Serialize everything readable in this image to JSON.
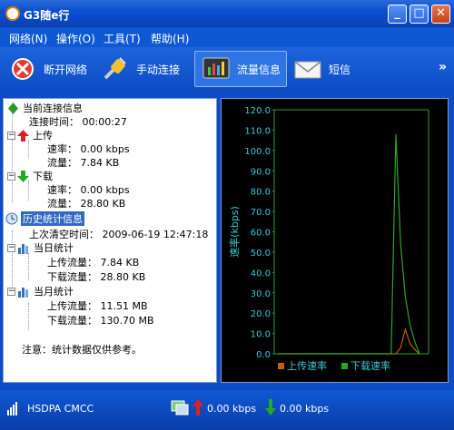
{
  "window": {
    "title": "G3随e行",
    "min_label": "_",
    "max_label": "□",
    "close_label": "✕"
  },
  "menu": [
    {
      "label": "网络(N)"
    },
    {
      "label": "操作(O)"
    },
    {
      "label": "工具(T)"
    },
    {
      "label": "帮助(H)"
    }
  ],
  "toolbar": {
    "disconnect": "断开网络",
    "manual_connect": "手动连接",
    "traffic_info": "流量信息",
    "sms": "短信",
    "more": "»"
  },
  "tree": {
    "current": "当前连接信息",
    "conn_time": "连接时间：  00:00:27",
    "upload": "上传",
    "up_rate": "速率：  0.00 kbps",
    "up_flow": "流量：  7.84 KB",
    "download": "下载",
    "down_rate": "速率：  0.00 kbps",
    "down_flow": "流量：  28.80 KB",
    "history": "历史统计信息",
    "last_clear": "上次清空时间：  2009-06-19 12:47:18",
    "today": "当日统计",
    "today_up": "上传流量：  7.84 KB",
    "today_down": "下载流量：  28.80 KB",
    "month": "当月统计",
    "month_up": "上传流量：  11.51 MB",
    "month_down": "下载流量：  130.70 MB",
    "note": "注意：统计数据仅供参考。"
  },
  "chart_data": {
    "type": "line",
    "ylabel": "速率(kbps)",
    "ylim": [
      0,
      120
    ],
    "yticks": [
      "120.0",
      "110.0",
      "100.0",
      "90.0",
      "80.0",
      "70.0",
      "60.0",
      "50.0",
      "40.0",
      "30.0",
      "20.0",
      "10.0",
      "0.0"
    ],
    "grid": false,
    "background": "#000000",
    "series": [
      {
        "name": "上传速率",
        "color": "#c06010",
        "x": [
          0,
          1,
          2,
          3,
          4,
          5,
          6,
          7,
          8,
          9,
          10,
          11,
          12,
          13,
          14,
          15,
          16,
          17,
          18,
          19,
          20,
          21,
          22,
          23,
          24,
          25,
          26,
          27,
          28,
          29,
          30
        ],
        "values": [
          0,
          0,
          0,
          0,
          0,
          0,
          0,
          0,
          0,
          0,
          0,
          0,
          0,
          0,
          0,
          0,
          0,
          0,
          0,
          0,
          0,
          0,
          0,
          0,
          0,
          0,
          3,
          12,
          5,
          2,
          0
        ]
      },
      {
        "name": "下载速率",
        "color": "#22aa22",
        "x": [
          0,
          1,
          2,
          3,
          4,
          5,
          6,
          7,
          8,
          9,
          10,
          11,
          12,
          13,
          14,
          15,
          16,
          17,
          18,
          19,
          20,
          21,
          22,
          23,
          24,
          25,
          26,
          27,
          28,
          29,
          30
        ],
        "values": [
          0,
          0,
          0,
          0,
          0,
          0,
          0,
          0,
          0,
          0,
          0,
          0,
          0,
          0,
          0,
          0,
          0,
          0,
          0,
          0,
          0,
          0,
          0,
          0,
          0,
          108,
          54,
          28,
          14,
          6,
          0
        ]
      }
    ],
    "legend": "bottom"
  },
  "status": {
    "network": "HSDPA CMCC",
    "up_speed": "0.00 kbps",
    "down_speed": "0.00 kbps"
  },
  "colors": {
    "accent": "#0b4fd1",
    "up": "#e02020",
    "down": "#22aa22"
  }
}
